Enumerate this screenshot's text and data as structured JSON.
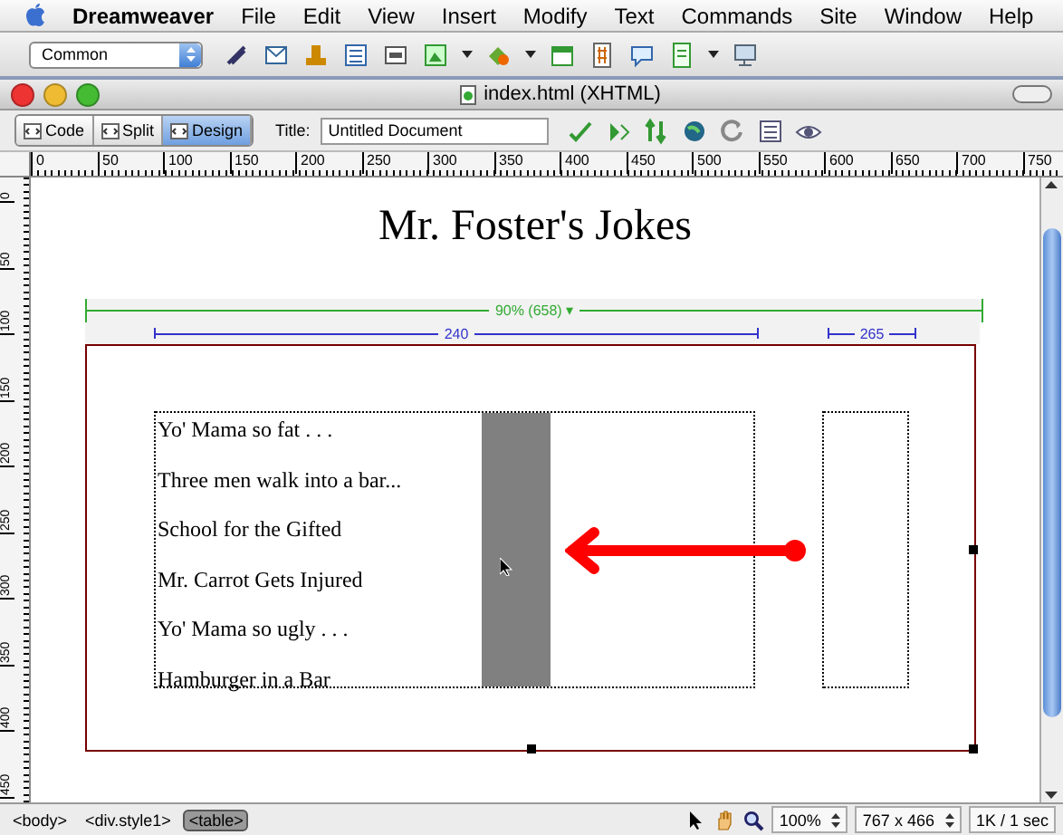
{
  "menubar": {
    "app": "Dreamweaver",
    "items": [
      "File",
      "Edit",
      "View",
      "Insert",
      "Modify",
      "Text",
      "Commands",
      "Site",
      "Window",
      "Help"
    ]
  },
  "insert_bar": {
    "category": "Common"
  },
  "window": {
    "title": "index.html (XHTML)"
  },
  "doc_toolbar": {
    "views": [
      {
        "label": "Code",
        "selected": false
      },
      {
        "label": "Split",
        "selected": false
      },
      {
        "label": "Design",
        "selected": true
      }
    ],
    "title_label": "Title:",
    "title_value": "Untitled Document"
  },
  "ruler": {
    "h_labels": [
      "0",
      "50",
      "100",
      "150",
      "200",
      "250",
      "300",
      "350",
      "400",
      "450",
      "500",
      "550",
      "600",
      "650",
      "700",
      "750"
    ],
    "v_labels": [
      "0",
      "50",
      "100",
      "150",
      "200",
      "250",
      "300",
      "350",
      "400",
      "450"
    ]
  },
  "page": {
    "heading": "Mr. Foster's Jokes",
    "table_width": "90% (658) ▾",
    "column_widths": [
      "240",
      "265"
    ],
    "jokes": [
      "Yo' Mama so fat . . .",
      "Three men walk into a bar...",
      "School for the Gifted",
      "Mr. Carrot Gets Injured",
      "Yo' Mama so ugly . . .",
      "Hamburger in a Bar"
    ]
  },
  "status_bar": {
    "tags": [
      {
        "label": "<body>",
        "selected": false
      },
      {
        "label": "<div.style1>",
        "selected": false
      },
      {
        "label": "<table>",
        "selected": true
      }
    ],
    "zoom": "100%",
    "size": "767 x 466",
    "download": "1K / 1 sec"
  }
}
